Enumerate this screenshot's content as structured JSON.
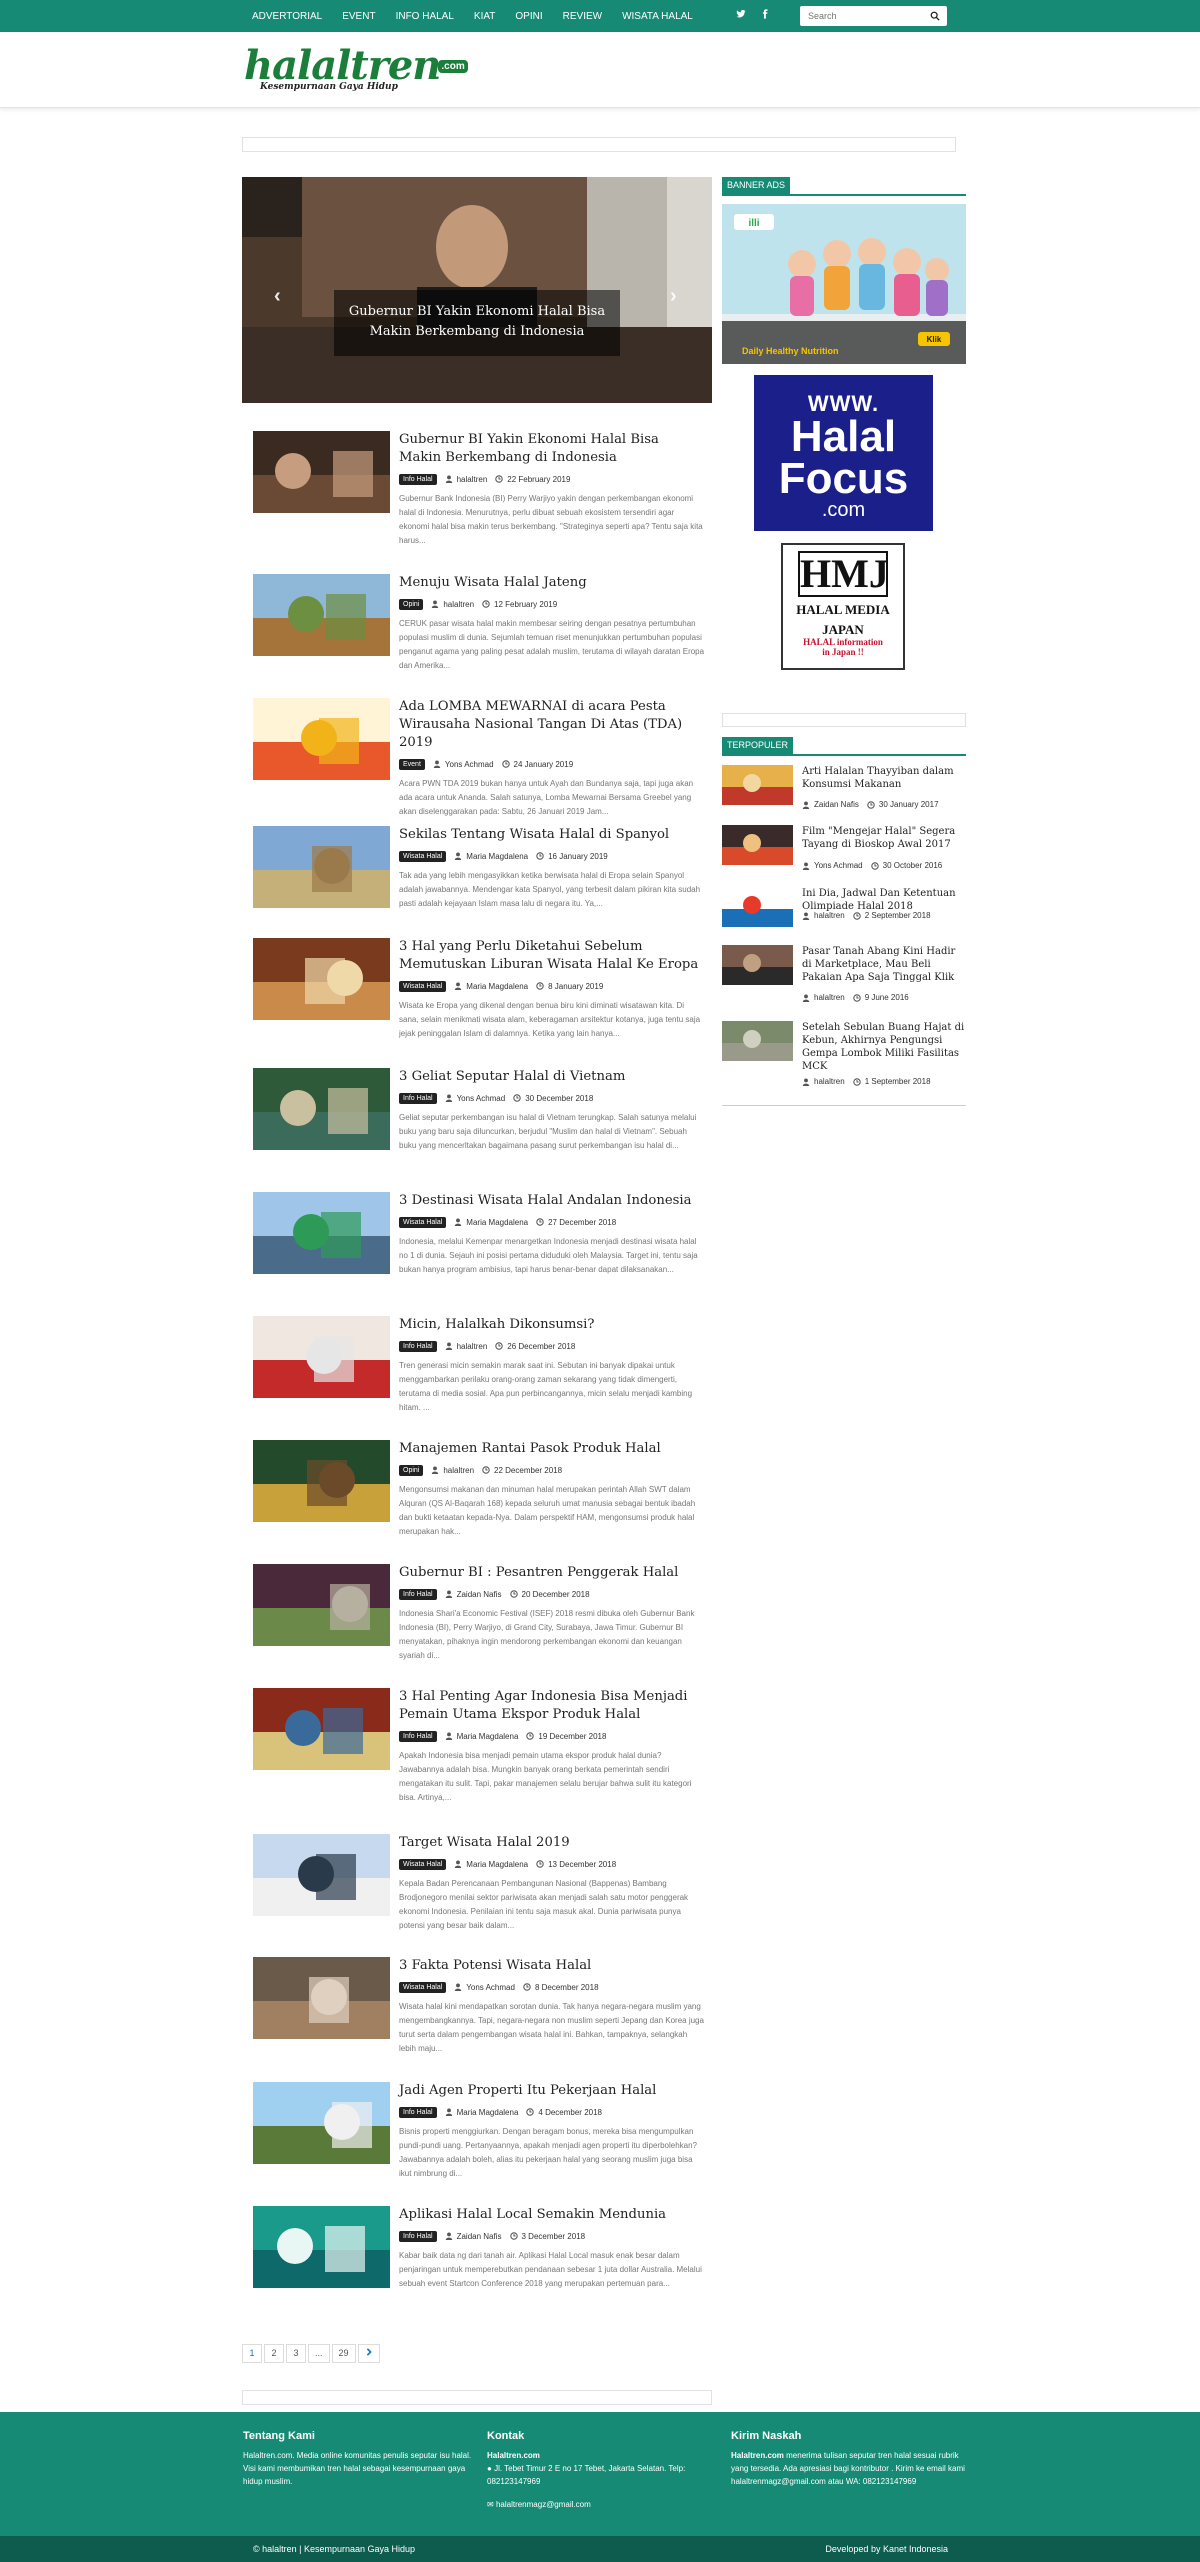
{
  "nav": {
    "items": [
      "ADVERTORIAL",
      "EVENT",
      "INFO HALAL",
      "KIAT",
      "OPINI",
      "REVIEW",
      "WISATA HALAL"
    ],
    "search_placeholder": "Search"
  },
  "brand": {
    "name": "halaltren",
    "suffix": ".com",
    "tagline": "Kesempurnaan Gaya Hidup",
    "color": "#168a74"
  },
  "slider": {
    "caption": "Gubernur BI Yakin Ekonomi Halal Bisa Makin Berkembang di Indonesia"
  },
  "posts": [
    {
      "title": "Gubernur BI Yakin Ekonomi Halal Bisa Makin Berkembang di Indonesia",
      "category": "Info Halal",
      "author": "halaltren",
      "date": "22 February 2019",
      "excerpt": "Gubernur Bank Indonesia (BI) Perry Warjiyo yakin dengan perkembangan ekonomi halal di Indonesia. Menurutnya, perlu dibuat sebuah ekosistem tersendiri agar ekonomi halal bisa makin terus berkembang. \"Strateginya seperti apa? Tentu saja kita harus..."
    },
    {
      "title": "Menuju Wisata Halal Jateng",
      "category": "Opini",
      "author": "halaltren",
      "date": "12 February 2019",
      "excerpt": "CERUK pasar wisata halal makin membesar seiring dengan pesatnya pertumbuhan populasi muslim di dunia. Sejumlah temuan riset menunjukkan pertumbuhan populasi penganut agama yang paling pesat adalah muslim, terutama di wilayah daratan Eropa dan Amerika..."
    },
    {
      "title": "Ada LOMBA MEWARNAI di acara Pesta Wirausaha Nasional Tangan Di Atas (TDA) 2019",
      "category": "Event",
      "author": "Yons Achmad",
      "date": "24 January 2019",
      "excerpt": "Acara PWN TDA 2019 bukan hanya untuk Ayah dan Bundanya saja, tapi juga akan ada acara untuk Ananda. Salah satunya, Lomba Mewarnai Bersama Greebel yang akan diselenggarakan pada: Sabtu, 26 Januari 2019 Jam..."
    },
    {
      "title": "Sekilas Tentang Wisata Halal di Spanyol",
      "category": "Wisata Halal",
      "author": "Maria Magdalena",
      "date": "16 January 2019",
      "excerpt": "Tak ada yang lebih mengasyikkan ketika berwisata halal di Eropa selain Spanyol adalah jawabannya. Mendengar kata Spanyol, yang terbesit dalam pikiran kita sudah pasti adalah kejayaan Islam masa lalu di negara itu.  Ya,..."
    },
    {
      "title": "3 Hal yang Perlu Diketahui Sebelum Memutuskan Liburan Wisata Halal Ke Eropa",
      "category": "Wisata Halal",
      "author": "Maria Magdalena",
      "date": "8 January 2019",
      "excerpt": "Wisata ke Eropa yang dikenal dengan benua biru kini diminati wisatawan kita. Di sana, selain menikmati wisata alam, keberagaman arsitektur kotanya, juga tentu saja jejak peninggalan Islam  di dalamnya. Ketika yang lain hanya..."
    },
    {
      "title": "3 Geliat Seputar Halal di Vietnam",
      "category": "Info Halal",
      "author": "Yons Achmad",
      "date": "30 December 2018",
      "excerpt": "Geliat seputar perkembangan isu halal di Vietnam terungkap. Salah satunya melalui buku yang baru saja diluncurkan, berjudul \"Muslim dan halal di Vietnam\".  Sebuah buku yang mencerltakan bagaimana pasang surut perkembangan isu halal di..."
    },
    {
      "title": "3 Destinasi Wisata Halal Andalan Indonesia",
      "category": "Wisata Halal",
      "author": "Maria Magdalena",
      "date": "27 December 2018",
      "excerpt": "Indonesia, melalui Kemenpar menargetkan Indonesia menjadi destinasi wisata halal no 1 di dunia.  Sejauh ini posisi pertama diduduki oleh Malaysia. Target ini, tentu saja bukan hanya program ambisius, tapi harus benar-benar dapat dilaksanakan..."
    },
    {
      "title": "Micin, Halalkah Dikonsumsi?",
      "category": "Info Halal",
      "author": "halaltren",
      "date": "26 December 2018",
      "excerpt": "Tren generasi micin semakin marak saat ini. Sebutan ini banyak dipakai untuk menggambarkan perilaku orang-orang zaman sekarang yang tidak dimengerti, terutama di media sosial. Apa pun perbincangannya, micin selalu menjadi kambing hitam.  ..."
    },
    {
      "title": "Manajemen Rantai Pasok Produk Halal",
      "category": "Opini",
      "author": "halaltren",
      "date": "22 December 2018",
      "excerpt": "Mengonsumsi makanan dan minuman halal merupakan perintah Allah SWT dalam Alquran (QS Al-Baqarah 168) kepada seluruh umat manusia sebagai bentuk ibadah dan bukti ketaatan kepada-Nya. Dalam perspektif HAM, mengonsumsi produk halal merupakan hak..."
    },
    {
      "title": "Gubernur BI : Pesantren Penggerak Halal",
      "category": "Info Halal",
      "author": "Zaidan Nafis",
      "date": "20 December 2018",
      "excerpt": "Indonesia Shari'a Economic Festival (ISEF) 2018 resmi dibuka oleh Gubernur Bank Indonesia (BI),  Perry Warjiyo,  di Grand City, Surabaya, Jawa Timur. Gubernur BI menyatakan, pihaknya ingin mendorong perkembangan ekonomi dan keuangan syariah di..."
    },
    {
      "title": "3 Hal Penting Agar Indonesia Bisa Menjadi Pemain Utama Ekspor Produk Halal",
      "category": "Info Halal",
      "author": "Maria Magdalena",
      "date": "19 December 2018",
      "excerpt": "Apakah Indonesia bisa menjadi pemain utama ekspor produk halal dunia? Jawabannya adalah bisa. Mungkin banyak orang berkata pemerintah sendiri mengatakan itu sulit. Tapi, pakar manajemen selalu berujar bahwa sulit itu kategori bisa. Artinya,..."
    },
    {
      "title": "Target Wisata Halal 2019",
      "category": "Wisata Halal",
      "author": "Maria Magdalena",
      "date": "13 December 2018",
      "excerpt": "Kepala Badan Perencanaan Pembangunan Nasional (Bappenas) Bambang Brodjonegoro menilai sektor pariwisata akan menjadi salah satu motor penggerak ekonomi Indonesia.  Penilaian ini tentu saja masuk akal. Dunia pariwisata punya potensi yang besar baik dalam..."
    },
    {
      "title": "3 Fakta Potensi Wisata Halal",
      "category": "Wisata Halal",
      "author": "Yons Achmad",
      "date": "8 December 2018",
      "excerpt": "Wisata halal kini mendapatkan sorotan dunia. Tak hanya negara-negara muslim yang mengembangkannya. Tapi, negara-negara non muslim seperti Jepang dan Korea juga turut serta dalam pengembangan wisata halal ini. Bahkan, tampaknya, selangkah lebih maju..."
    },
    {
      "title": "Jadi Agen Properti Itu Pekerjaan Halal",
      "category": "Info Halal",
      "author": "Maria Magdalena",
      "date": "4 December 2018",
      "excerpt": "Bisnis properti menggiurkan. Dengan beragam bonus, mereka bisa mengumpulkan pundi-pundi uang. Pertanyaannya, apakah menjadi agen properti itu diperbolehkan? Jawabannya adalah boleh, alias itu pekerjaan halal yang seorang muslim juga bisa ikut nimbrung di..."
    },
    {
      "title": "Aplikasi Halal Local Semakin Mendunia",
      "category": "Info Halal",
      "author": "Zaidan Nafis",
      "date": "3 December 2018",
      "excerpt": "Kabar baik data ng dari tanah air. Aplikasi Halal Local masuk enak besar dalam penjaringan untuk memperebutkan pendanaan sebesar 1 juta dollar Australia. Melalui sebuah event Startcon Conference 2018 yang merupakan pertemuan para..."
    }
  ],
  "pagination": [
    "1",
    "2",
    "3",
    "...",
    "29"
  ],
  "sidebar": {
    "banner_title": "BANNER ADS",
    "banner1": {
      "brand": "illi",
      "footer": "Daily Healthy Nutrition",
      "cta": "Klik"
    },
    "halalfocus": {
      "l1": "WWW.",
      "l2": "Halal",
      "l3": "Focus",
      "l4": ".com"
    },
    "hmj": {
      "mark": "HMJ",
      "l1": "HALAL MEDIA",
      "l2": "JAPAN",
      "l3": "HALAL information",
      "l4": "in Japan !!"
    },
    "popular_title": "TERPOPULER",
    "popular": [
      {
        "title": "Arti Halalan Thayyiban dalam Konsumsi Makanan",
        "author": "Zaidan Nafis",
        "date": "30 January 2017"
      },
      {
        "title": "Film \"Mengejar Halal\" Segera Tayang di Bioskop Awal 2017",
        "author": "Yons Achmad",
        "date": "30 October 2016"
      },
      {
        "title": "Ini Dia, Jadwal Dan Ketentuan Olimpiade Halal 2018",
        "author": "halaltren",
        "date": "2 September 2018"
      },
      {
        "title": "Pasar Tanah Abang Kini Hadir di Marketplace, Mau Beli Pakaian Apa Saja Tinggal Klik",
        "author": "halaltren",
        "date": "9 June 2016"
      },
      {
        "title": "Setelah Sebulan Buang Hajat di Kebun, Akhirnya Pengungsi Gempa Lombok Miliki Fasilitas MCK",
        "author": "halaltren",
        "date": "1 September 2018"
      }
    ]
  },
  "footer": {
    "about_title": "Tentang Kami",
    "about_text": "Halaltren.com. Media online komunitas penulis seputar isu halal. Visi kami membumikan tren halal sebagai kesempurnaan gaya hidup muslim.",
    "contact_title": "Kontak",
    "contact_name": "Halaltren.com",
    "contact_address": "Jl. Tebet Timur 2 E no 17 Tebet, Jakarta Selatan. Telp: 082123147969",
    "contact_email": "halaltrenmagz@gmail.com",
    "send_title": "Kirim Naskah",
    "send_lead": "Halaltren.com",
    "send_text": " menerima tulisan seputar tren halal sesuai rubrik yang tersedia. Ada apresiasi bagi kontributor . Kirim ke email kami halaltrenmagz@gmail.com atau WA: 082123147969",
    "copyright": "© halaltren | Kesempurnaan Gaya Hidup",
    "developer": "Developed by Kanet Indonesia"
  }
}
